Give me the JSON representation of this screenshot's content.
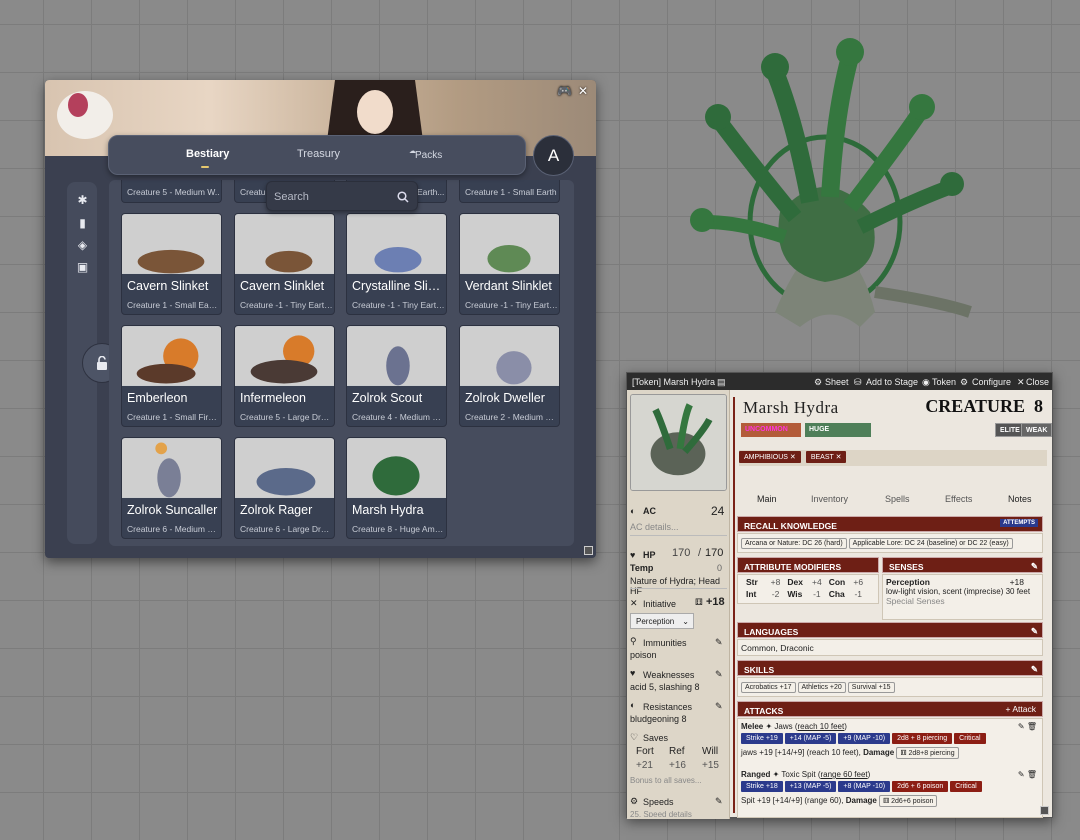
{
  "compendium": {
    "tabs": [
      "Bestiary",
      "Treasury",
      "Packs"
    ],
    "avatar_letter": "A",
    "search_placeholder": "Search",
    "top_strip": [
      "Creature 5 - Medium W...",
      "Creatur",
      "Earth...",
      "Creature 1 - Small Earth..."
    ],
    "cards": [
      {
        "name": "Cavern Slinket",
        "sub": "Creature 1 - Small Earth..."
      },
      {
        "name": "Cavern Slinklet",
        "sub": "Creature -1 - Tiny Earth ..."
      },
      {
        "name": "Crystalline Slink...",
        "sub": "Creature -1 - Tiny Earth ..."
      },
      {
        "name": "Verdant Slinklet",
        "sub": "Creature -1 - Tiny Earth ..."
      },
      {
        "name": "Emberleon",
        "sub": "Creature 1 - Small Fire ..."
      },
      {
        "name": "Infermeleon",
        "sub": "Creature 5 - Large Drag..."
      },
      {
        "name": "Zolrok Scout",
        "sub": "Creature 4 - Medium Hu..."
      },
      {
        "name": "Zolrok Dweller",
        "sub": "Creature 2 - Medium Hu..."
      },
      {
        "name": "Zolrok Suncaller",
        "sub": "Creature 6 - Medium Dr..."
      },
      {
        "name": "Zolrok Rager",
        "sub": "Creature 6 - Large Drag..."
      },
      {
        "name": "Marsh Hydra",
        "sub": "Creature 8 - Huge Amp..."
      }
    ]
  },
  "sheet": {
    "window_title": "[Token] Marsh Hydra",
    "header_buttons": [
      "Sheet",
      "Add to Stage",
      "Token",
      "Configure",
      "Close"
    ],
    "name": "Marsh Hydra",
    "creature_label": "CREATURE",
    "level": "8",
    "rarity": "UNCOMMON",
    "size": "HUGE",
    "traits": [
      "AMPHIBIOUS",
      "BEAST"
    ],
    "elite_label": "ELITE",
    "weak_label": "WEAK",
    "nav": [
      "Main",
      "Inventory",
      "Spells",
      "Effects",
      "Notes"
    ],
    "ac_label": "AC",
    "ac_value": "24",
    "ac_details": "AC details...",
    "hp_label": "HP",
    "hp_value": "170",
    "hp_max": "170",
    "temp_label": "Temp",
    "temp_value": "0",
    "hp_notes": "Nature of Hydra; Head HF",
    "initiative_label": "Initiative",
    "initiative_value": "+18",
    "initiative_skill": "Perception",
    "immunities_label": "Immunities",
    "immunities": "poison",
    "weaknesses_label": "Weaknesses",
    "weaknesses": "acid 5, slashing 8",
    "resistances_label": "Resistances",
    "resistances": "bludgeoning 8",
    "saves_label": "Saves",
    "saves": [
      {
        "name": "Fort",
        "value": "+21"
      },
      {
        "name": "Ref",
        "value": "+16"
      },
      {
        "name": "Will",
        "value": "+15"
      }
    ],
    "saves_bonus": "Bonus to all saves...",
    "speeds_label": "Speeds",
    "speeds_value": "25, Speed details",
    "recall_label": "RECALL KNOWLEDGE",
    "attempts_label": "ATTEMPTS",
    "recall_pills": [
      "Arcana or Nature: DC 26 (hard)",
      "Applicable Lore: DC 24 (baseline) or DC 22 (easy)"
    ],
    "attr_label": "ATTRIBUTE MODIFIERS",
    "attrs": [
      [
        "Str",
        "+8",
        "Dex",
        "+4",
        "Con",
        "+6"
      ],
      [
        "Int",
        "-2",
        "Wis",
        "-1",
        "Cha",
        "-1"
      ]
    ],
    "senses_label": "SENSES",
    "perception_label": "Perception",
    "perception_value": "+18",
    "senses_text": "low-light vision, scent (imprecise) 30 feet",
    "special_senses": "Special Senses",
    "languages_label": "LANGUAGES",
    "languages": "Common, Draconic",
    "skills_label": "SKILLS",
    "skills": [
      "Acrobatics +17",
      "Athletics +20",
      "Survival +15"
    ],
    "attacks_label": "ATTACKS",
    "attack_button": "Attack",
    "attacks": [
      {
        "kind": "Melee",
        "name": "Jaws",
        "range": "reach 10 feet",
        "strikes": [
          "Strike +19",
          "+14 (MAP -5)",
          "+9 (MAP -10)"
        ],
        "damage": "2d8 + 8 piercing",
        "crit": "Critical",
        "summary": "jaws +19 [+14/+9] (reach 10 feet), ",
        "dmg_label": "Damage",
        "dmg_pill": "2d8+8 piercing"
      },
      {
        "kind": "Ranged",
        "name": "Toxic Spit",
        "range": "range 60 feet",
        "strikes": [
          "Strike +18",
          "+13 (MAP -5)",
          "+8 (MAP -10)"
        ],
        "damage": "2d6 + 6 poison",
        "crit": "Critical",
        "summary": "Spit +19 [+14/+9] (range 60), ",
        "dmg_label": "Damage",
        "dmg_pill": "2d6+6 poison"
      }
    ]
  },
  "colors": {
    "accent": "#6e1f15",
    "strike_blue": "#2b3a8c",
    "damage_red": "#8c1e14"
  }
}
